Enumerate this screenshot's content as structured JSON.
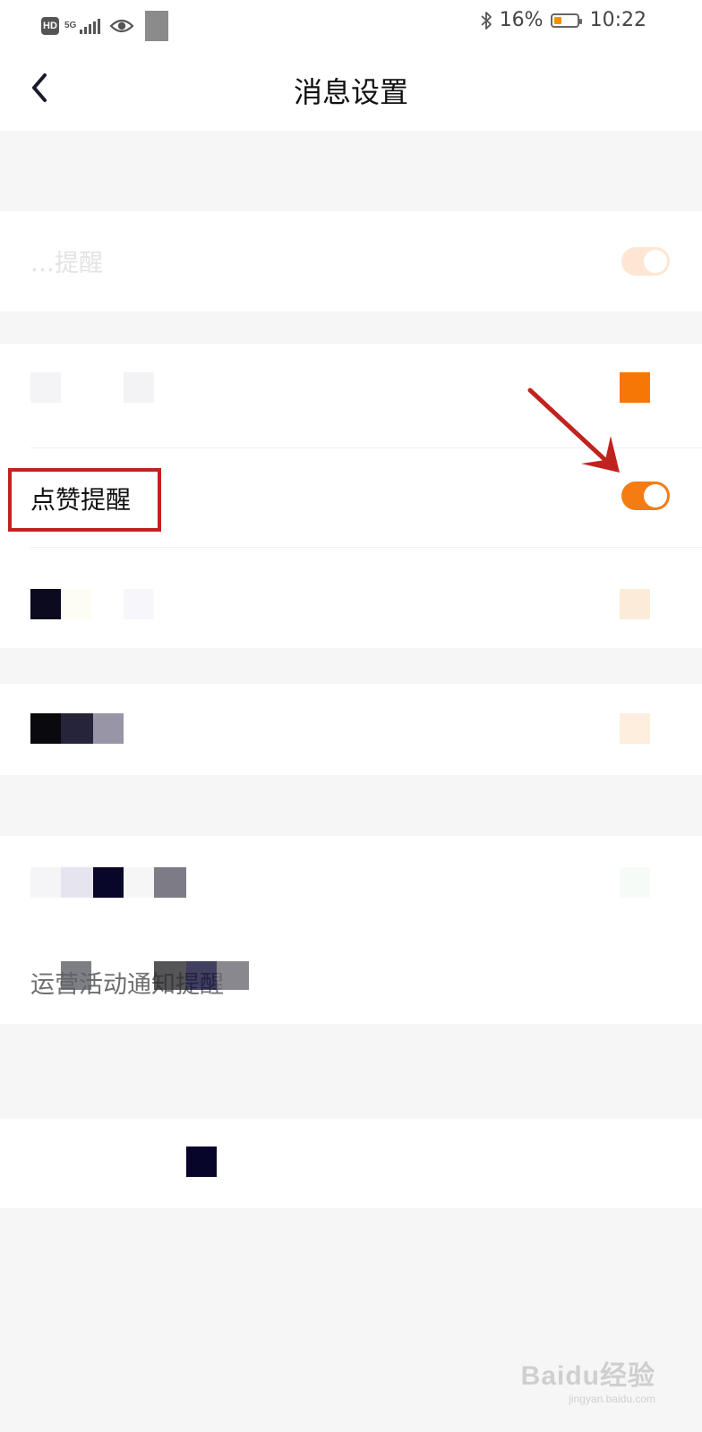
{
  "status_bar": {
    "hd_badge": "HD",
    "network": "5G",
    "bluetooth_icon": "bluetooth-icon",
    "battery_percent": "16%",
    "battery_level": 0.16,
    "time": "10:22"
  },
  "nav": {
    "back_icon": "chevron-left-icon",
    "title": "消息设置"
  },
  "settings": {
    "faded_row_1_label": "…提醒",
    "like_reminder_label": "点赞提醒",
    "like_reminder_on": true,
    "activity_notice_label": "运营活动通知提醒"
  },
  "colors": {
    "accent": "#f57c12",
    "annotation": "#c0231f"
  },
  "watermark": {
    "main": "Baidu经验",
    "sub": "jingyan.baidu.com"
  }
}
